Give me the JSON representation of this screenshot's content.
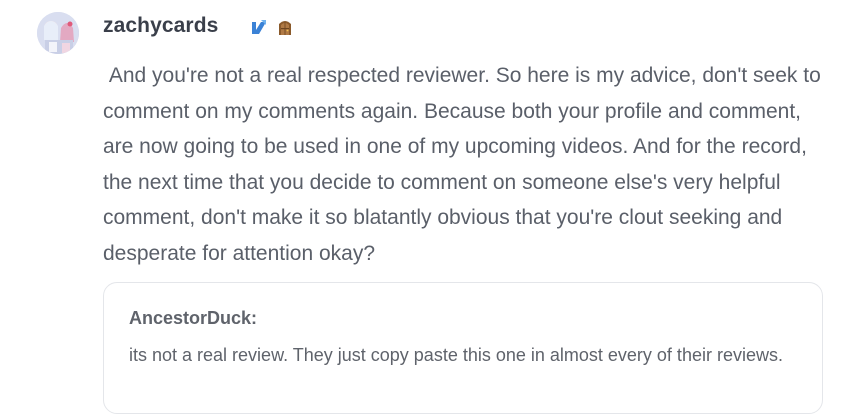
{
  "comment": {
    "username": "zachycards",
    "avatar_icon": "avatar-image",
    "badges": [
      {
        "icon": "verified-pen-icon",
        "color": "#3b82d6"
      },
      {
        "icon": "door-icon",
        "color": "#8a5a2b"
      }
    ],
    "message": " And you're not a real respected reviewer. So here is my advice, don't seek to comment on my comments again. Because both your profile and comment, are now going to be used in one of my upcoming videos. And for the record, the next time that you decide to comment on someone else's very helpful comment, don't make it so blatantly obvious that you're clout seeking and desperate for attention okay?"
  },
  "quote": {
    "author": "AncestorDuck:",
    "text": "its not a real review. They just copy paste this one in almost every of their reviews."
  },
  "colors": {
    "username": "#3a3f4a",
    "message": "#5a5f69",
    "quote_border": "#e4e6ea"
  }
}
